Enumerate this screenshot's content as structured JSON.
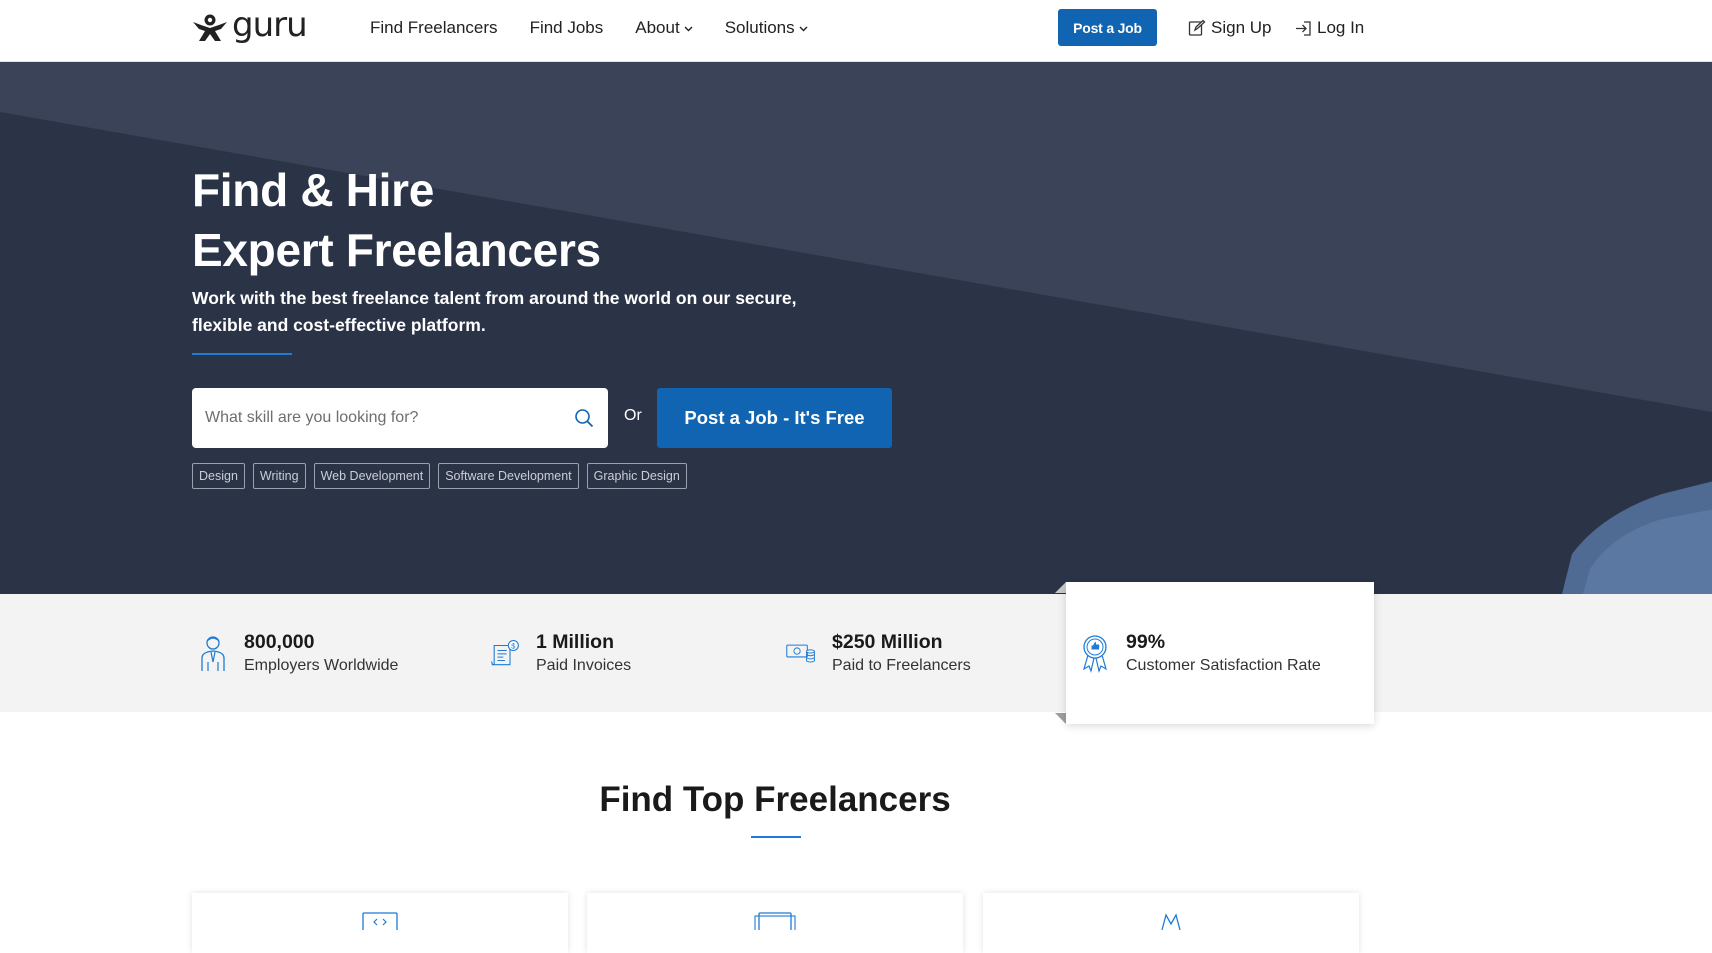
{
  "header": {
    "logo_text": "guru",
    "nav": [
      {
        "label": "Find Freelancers"
      },
      {
        "label": "Find Jobs"
      },
      {
        "label": "About",
        "dropdown": true
      },
      {
        "label": "Solutions",
        "dropdown": true
      }
    ],
    "post_job_label": "Post a Job",
    "signup_label": "Sign Up",
    "login_label": "Log In"
  },
  "hero": {
    "title_line1": "Find & Hire",
    "title_line2": "Expert Freelancers",
    "subtitle_line1": "Work with the best freelance talent from around the world on our secure,",
    "subtitle_line2": "flexible and cost-effective platform.",
    "search_placeholder": "What skill are you looking for?",
    "or_label": "Or",
    "post_job_big_label": "Post a Job - It's Free",
    "tags": [
      "Design",
      "Writing",
      "Web Development",
      "Software Development",
      "Graphic Design"
    ]
  },
  "stats": [
    {
      "value": "800,000",
      "label": "Employers Worldwide",
      "icon": "employer-icon"
    },
    {
      "value": "1 Million",
      "label": "Paid Invoices",
      "icon": "invoice-icon"
    },
    {
      "value": "$250 Million",
      "label": "Paid to Freelancers",
      "icon": "money-icon"
    },
    {
      "value": "99%",
      "label": "Customer Satisfaction Rate",
      "icon": "award-icon"
    }
  ],
  "section": {
    "title": "Find Top Freelancers"
  },
  "colors": {
    "brand_blue": "#1064b2",
    "hero_bg": "#3a4357",
    "hero_dark": "#2b3347",
    "accent_rule": "#1f7bd6"
  }
}
